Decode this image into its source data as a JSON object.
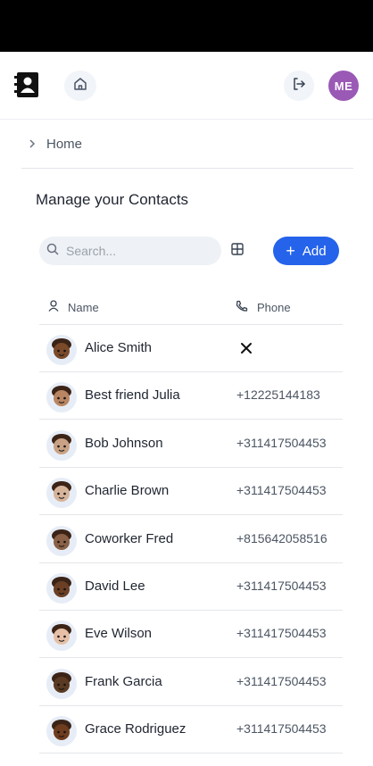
{
  "header": {
    "logo_icon": "address-book-icon",
    "home_icon": "home-icon",
    "logout_icon": "logout-icon",
    "avatar_initials": "ME",
    "avatar_color": "#9b59b6"
  },
  "breadcrumb": {
    "items": [
      "Home"
    ]
  },
  "page": {
    "title": "Manage your Contacts"
  },
  "toolbar": {
    "search_placeholder": "Search...",
    "add_label": "Add",
    "accent": "#2563eb"
  },
  "table": {
    "columns": {
      "name": "Name",
      "phone": "Phone"
    },
    "rows": [
      {
        "name": "Alice Smith",
        "phone": "",
        "action": "close-icon",
        "avatar_skin": "#7a4a2a"
      },
      {
        "name": "Best friend Julia",
        "phone": "+12225144183",
        "avatar_skin": "#b98562"
      },
      {
        "name": "Bob Johnson",
        "phone": "+311417504453",
        "avatar_skin": "#c9a184"
      },
      {
        "name": "Charlie Brown",
        "phone": "+311417504453",
        "avatar_skin": "#d6b49a"
      },
      {
        "name": "Coworker Fred",
        "phone": "+815642058516",
        "avatar_skin": "#8a6146"
      },
      {
        "name": "David Lee",
        "phone": "+311417504453",
        "avatar_skin": "#6b3f24"
      },
      {
        "name": "Eve Wilson",
        "phone": "+311417504453",
        "avatar_skin": "#e6bfa6"
      },
      {
        "name": "Frank Garcia",
        "phone": "+311417504453",
        "avatar_skin": "#5a3a22"
      },
      {
        "name": "Grace Rodriguez",
        "phone": "+311417504453",
        "avatar_skin": "#6e3c1e"
      }
    ]
  }
}
